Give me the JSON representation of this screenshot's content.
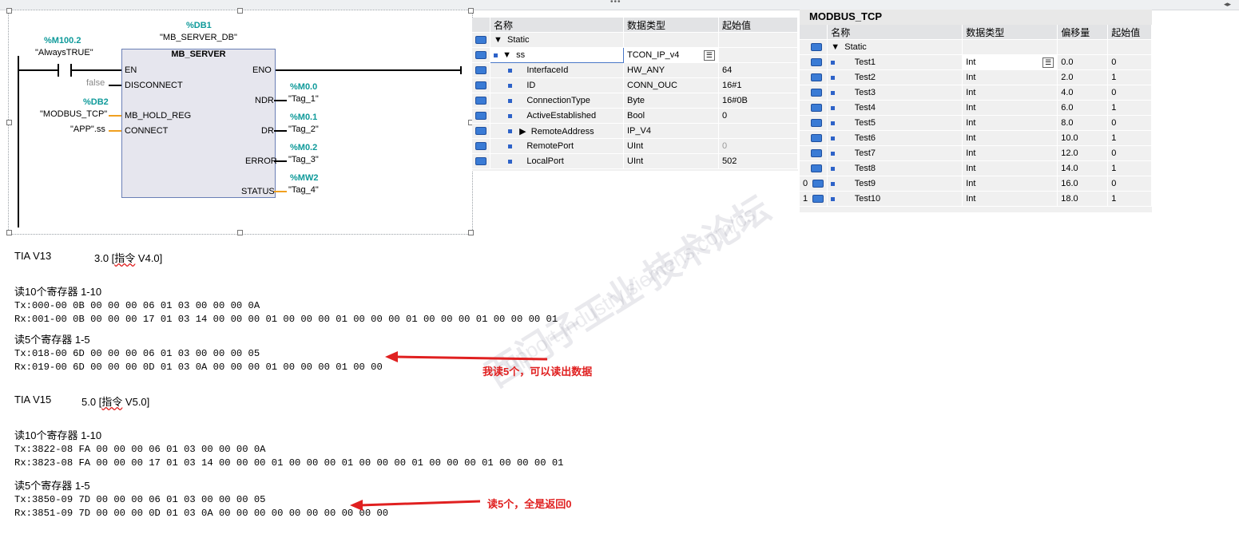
{
  "ladder": {
    "db_addr": "%DB1",
    "db_name": "\"MB_SERVER_DB\"",
    "contact_addr": "%M100.2",
    "contact_name": "\"AlwaysTRUE\"",
    "fb_name": "MB_SERVER",
    "pins_left": [
      "EN",
      "DISCONNECT",
      "MB_HOLD_REG",
      "CONNECT"
    ],
    "pins_right": [
      "ENO",
      "NDR",
      "DR",
      "ERROR",
      "STATUS"
    ],
    "disconnect_val": "false",
    "hold_addr": "%DB2",
    "hold_name": "\"MODBUS_TCP\"",
    "connect_name": "\"APP\".ss",
    "outputs": [
      {
        "addr": "%M0.0",
        "name": "\"Tag_1\""
      },
      {
        "addr": "%M0.1",
        "name": "\"Tag_2\""
      },
      {
        "addr": "%M0.2",
        "name": "\"Tag_3\""
      },
      {
        "addr": "%MW2",
        "name": "\"Tag_4\""
      }
    ]
  },
  "table1": {
    "headers": [
      "名称",
      "数据类型",
      "起始值"
    ],
    "rows": [
      {
        "name": "Static",
        "type": "",
        "value": ""
      },
      {
        "name": "ss",
        "type": "TCON_IP_v4",
        "value": ""
      },
      {
        "name": "InterfaceId",
        "type": "HW_ANY",
        "value": "64"
      },
      {
        "name": "ID",
        "type": "CONN_OUC",
        "value": "16#1"
      },
      {
        "name": "ConnectionType",
        "type": "Byte",
        "value": "16#0B"
      },
      {
        "name": "ActiveEstablished",
        "type": "Bool",
        "value": "0"
      },
      {
        "name": "RemoteAddress",
        "type": "IP_V4",
        "value": ""
      },
      {
        "name": "RemotePort",
        "type": "UInt",
        "value": "0"
      },
      {
        "name": "LocalPort",
        "type": "UInt",
        "value": "502"
      }
    ]
  },
  "table2": {
    "title": "MODBUS_TCP",
    "headers": [
      "名称",
      "数据类型",
      "偏移量",
      "起始值"
    ],
    "rows": [
      {
        "name": "Static",
        "type": "",
        "offset": "",
        "value": ""
      },
      {
        "name": "Test1",
        "type": "Int",
        "offset": "0.0",
        "value": "0"
      },
      {
        "name": "Test2",
        "type": "Int",
        "offset": "2.0",
        "value": "1"
      },
      {
        "name": "Test3",
        "type": "Int",
        "offset": "4.0",
        "value": "0"
      },
      {
        "name": "Test4",
        "type": "Int",
        "offset": "6.0",
        "value": "1"
      },
      {
        "name": "Test5",
        "type": "Int",
        "offset": "8.0",
        "value": "0"
      },
      {
        "name": "Test6",
        "type": "Int",
        "offset": "10.0",
        "value": "1"
      },
      {
        "name": "Test7",
        "type": "Int",
        "offset": "12.0",
        "value": "0"
      },
      {
        "name": "Test8",
        "type": "Int",
        "offset": "14.0",
        "value": "1"
      },
      {
        "name": "Test9",
        "type": "Int",
        "offset": "16.0",
        "value": "0"
      },
      {
        "name": "Test10",
        "type": "Int",
        "offset": "18.0",
        "value": "1"
      }
    ],
    "row_nums": [
      "0",
      "1"
    ]
  },
  "notes": {
    "v13_label": "TIA V13",
    "v13_ver_pre": "3.0 [",
    "v13_ver_word": "指令",
    "v13_ver_post": " V4.0]",
    "read10_a": "读10个寄存器 1-10",
    "tx1": "Tx:000-00 0B 00 00 00 06 01 03 00 00 00 0A",
    "rx1": "Rx:001-00 0B 00 00 00 17 01 03 14 00 00 00 01 00 00 00 01 00 00 00 01 00 00 00 01 00 00 00 01",
    "read5_a": "读5个寄存器 1-5",
    "tx2": "Tx:018-00 6D 00 00 00 06 01 03 00 00 00 05",
    "rx2": "Rx:019-00 6D 00 00 00 0D 01 03 0A 00 00 00 01 00 00 00 01 00 00",
    "note1": "我读5个，可以读出数据",
    "v15_label": "TIA V15",
    "v15_ver_pre": "5.0 [",
    "v15_ver_word": "指令",
    "v15_ver_post": " V5.0]",
    "read10_b": "读10个寄存器 1-10",
    "tx3": "Tx:3822-08 FA 00 00 00 06 01 03 00 00 00 0A",
    "rx3": "Rx:3823-08 FA 00 00 00 17 01 03 14 00 00 00 01 00 00 00 01 00 00 00 01 00 00 00 01 00 00 00 01",
    "read5_b": "读5个寄存器 1-5",
    "tx4": "Tx:3850-09 7D 00 00 00 06 01 03 00 00 00 05",
    "rx4": "Rx:3851-09 7D 00 00 00 0D 01 03 0A 00 00 00 00 00 00 00 00 00 00",
    "note2": "读5个，全是返回0"
  },
  "watermark": {
    "text1": "西门子工业 技术论坛",
    "text2": "support.industry.siemens.com/cs"
  },
  "colors": {
    "teal": "#0f9a9a",
    "red_note": "#e02020",
    "fb_fill": "#e6e6ee",
    "pin_orange": "#f0a020"
  }
}
